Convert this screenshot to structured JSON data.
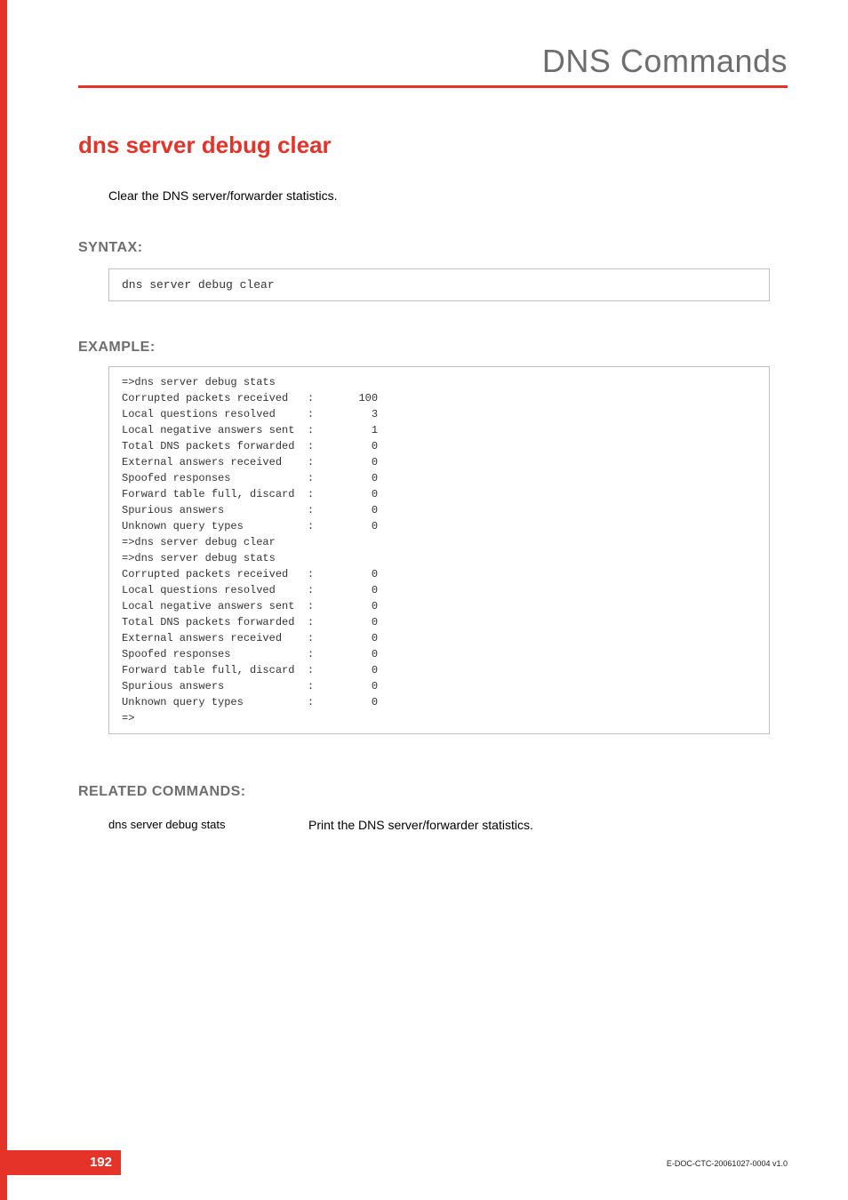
{
  "header": {
    "title": "DNS Commands"
  },
  "main": {
    "title": "dns server debug clear",
    "description": "Clear the DNS server/forwarder statistics."
  },
  "syntax": {
    "heading": "SYNTAX:",
    "code": "dns server debug clear"
  },
  "example": {
    "heading": "EXAMPLE:",
    "lines": [
      "=>dns server debug stats",
      "Corrupted packets received   :       100",
      "Local questions resolved     :         3",
      "Local negative answers sent  :         1",
      "Total DNS packets forwarded  :         0",
      "External answers received    :         0",
      "Spoofed responses            :         0",
      "Forward table full, discard  :         0",
      "Spurious answers             :         0",
      "Unknown query types          :         0",
      "=>dns server debug clear",
      "=>dns server debug stats",
      "Corrupted packets received   :         0",
      "Local questions resolved     :         0",
      "Local negative answers sent  :         0",
      "Total DNS packets forwarded  :         0",
      "External answers received    :         0",
      "Spoofed responses            :         0",
      "Forward table full, discard  :         0",
      "Spurious answers             :         0",
      "Unknown query types          :         0",
      "=>"
    ]
  },
  "related": {
    "heading": "RELATED COMMANDS:",
    "items": [
      {
        "cmd": "dns server debug stats",
        "desc": "Print the DNS server/forwarder statistics."
      }
    ]
  },
  "footer": {
    "page": "192",
    "docid": "E-DOC-CTC-20061027-0004 v1.0"
  }
}
